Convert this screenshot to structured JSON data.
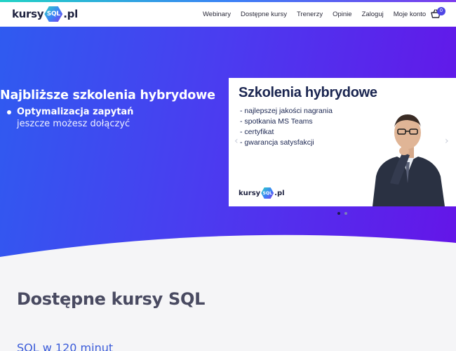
{
  "header": {
    "logo_left": "kursy",
    "logo_hex": "SQL",
    "logo_right": ".pl",
    "nav": [
      "Webinary",
      "Dostępne kursy",
      "Trenerzy",
      "Opinie",
      "Zaloguj",
      "Moje konto"
    ],
    "cart_count": "0",
    "cart_icon": "basket-icon"
  },
  "hero": {
    "title": "Najbliższe szkolenia hybrydowe",
    "course": "Optymalizacja zapytań",
    "subtitle": "jeszcze możesz dołączyć"
  },
  "banner": {
    "title": "Szkolenia hybrydowe",
    "items": [
      "- najlepszej jakości nagrania",
      "- spotkania MS Teams",
      "- certyfikat",
      "- gwarancja satysfakcji"
    ],
    "logo_left": "kursy",
    "logo_hex": "SQL",
    "logo_right": ".pl",
    "prev_icon": "chevron-left-icon",
    "next_icon": "chevron-right-icon"
  },
  "carousel": {
    "active_index": 0,
    "count": 2
  },
  "main": {
    "section_title": "Dostępne kursy SQL",
    "course_title": "SQL w 120 minut"
  },
  "colors": {
    "hero_start": "#2f5bf0",
    "hero_end": "#6415e8",
    "heading": "#494a61",
    "link": "#3a5bd9"
  }
}
